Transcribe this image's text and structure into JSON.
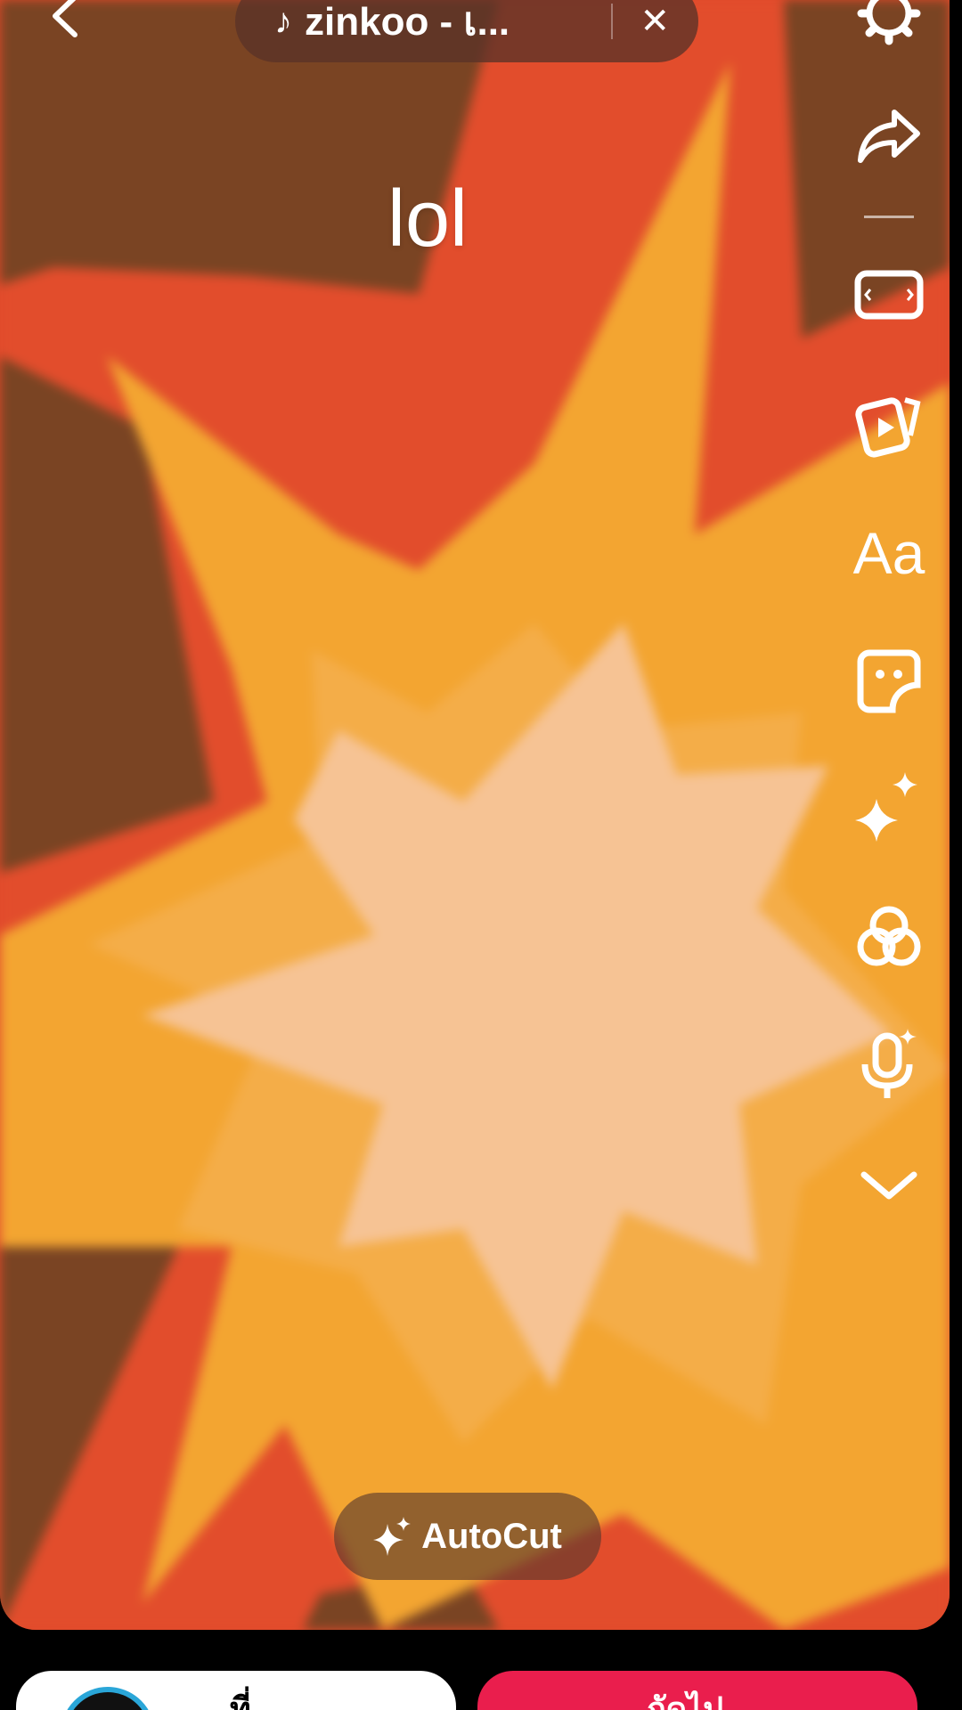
{
  "top": {
    "music_note": "♪",
    "music_title": "zinkoo - เ...",
    "close_symbol": "✕"
  },
  "overlay_text": "lol",
  "toolbar": {
    "text_tool_label": "Aa",
    "tools": [
      "settings-icon",
      "share-icon",
      "aspect-ratio-icon",
      "templates-icon",
      "text-icon",
      "sticker-icon",
      "effects-icon",
      "filters-icon",
      "voice-effects-icon",
      "chevron-down-icon"
    ]
  },
  "autocut": {
    "label": "AutoCut"
  },
  "bottom": {
    "left_button_label": "ที่",
    "right_button_label": "ถัดไป"
  },
  "colors": {
    "accent_red": "#ea1e4d",
    "avatar_ring": "#2aa6d8"
  }
}
